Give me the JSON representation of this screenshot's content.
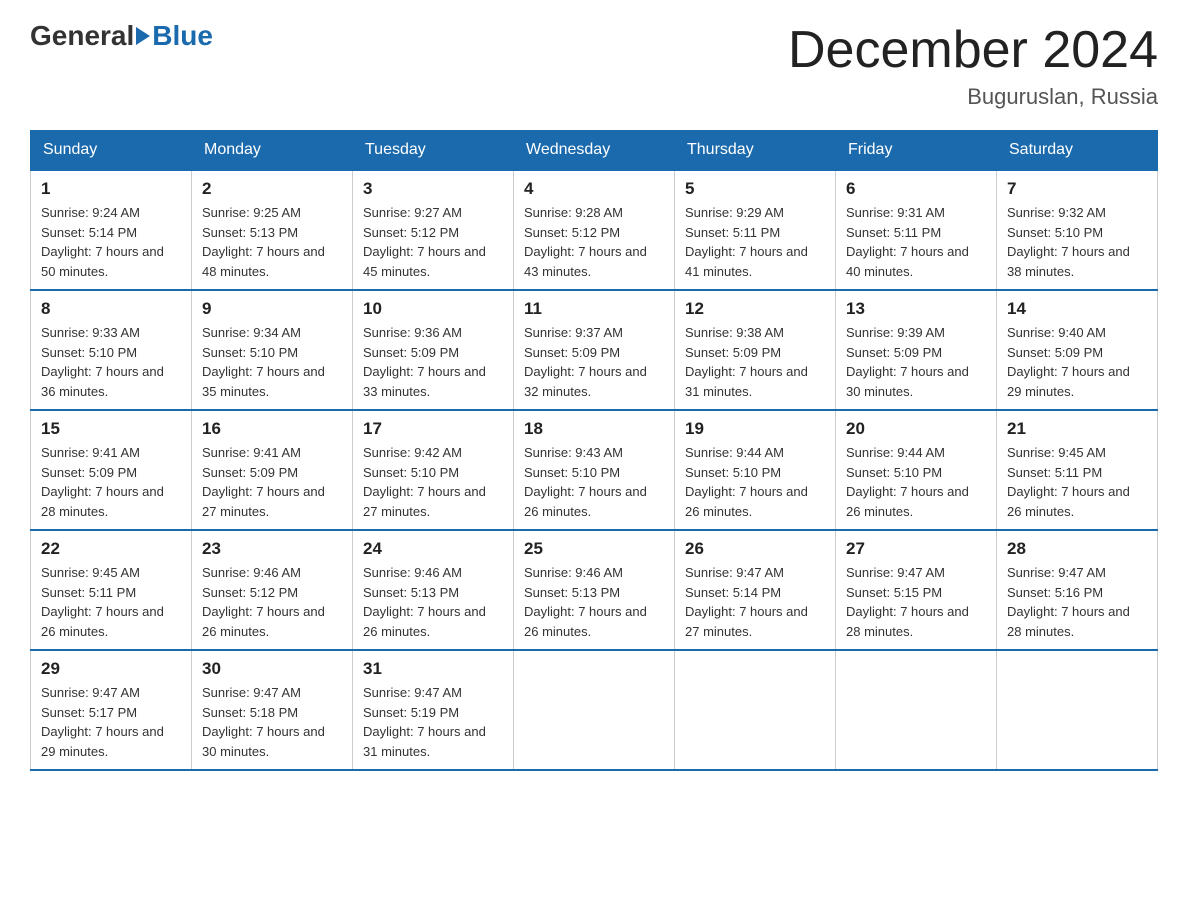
{
  "header": {
    "logo_general": "General",
    "logo_blue": "Blue",
    "month_title": "December 2024",
    "location": "Buguruslan, Russia"
  },
  "days_of_week": [
    "Sunday",
    "Monday",
    "Tuesday",
    "Wednesday",
    "Thursday",
    "Friday",
    "Saturday"
  ],
  "weeks": [
    [
      {
        "day": "1",
        "sunrise": "9:24 AM",
        "sunset": "5:14 PM",
        "daylight": "7 hours and 50 minutes."
      },
      {
        "day": "2",
        "sunrise": "9:25 AM",
        "sunset": "5:13 PM",
        "daylight": "7 hours and 48 minutes."
      },
      {
        "day": "3",
        "sunrise": "9:27 AM",
        "sunset": "5:12 PM",
        "daylight": "7 hours and 45 minutes."
      },
      {
        "day": "4",
        "sunrise": "9:28 AM",
        "sunset": "5:12 PM",
        "daylight": "7 hours and 43 minutes."
      },
      {
        "day": "5",
        "sunrise": "9:29 AM",
        "sunset": "5:11 PM",
        "daylight": "7 hours and 41 minutes."
      },
      {
        "day": "6",
        "sunrise": "9:31 AM",
        "sunset": "5:11 PM",
        "daylight": "7 hours and 40 minutes."
      },
      {
        "day": "7",
        "sunrise": "9:32 AM",
        "sunset": "5:10 PM",
        "daylight": "7 hours and 38 minutes."
      }
    ],
    [
      {
        "day": "8",
        "sunrise": "9:33 AM",
        "sunset": "5:10 PM",
        "daylight": "7 hours and 36 minutes."
      },
      {
        "day": "9",
        "sunrise": "9:34 AM",
        "sunset": "5:10 PM",
        "daylight": "7 hours and 35 minutes."
      },
      {
        "day": "10",
        "sunrise": "9:36 AM",
        "sunset": "5:09 PM",
        "daylight": "7 hours and 33 minutes."
      },
      {
        "day": "11",
        "sunrise": "9:37 AM",
        "sunset": "5:09 PM",
        "daylight": "7 hours and 32 minutes."
      },
      {
        "day": "12",
        "sunrise": "9:38 AM",
        "sunset": "5:09 PM",
        "daylight": "7 hours and 31 minutes."
      },
      {
        "day": "13",
        "sunrise": "9:39 AM",
        "sunset": "5:09 PM",
        "daylight": "7 hours and 30 minutes."
      },
      {
        "day": "14",
        "sunrise": "9:40 AM",
        "sunset": "5:09 PM",
        "daylight": "7 hours and 29 minutes."
      }
    ],
    [
      {
        "day": "15",
        "sunrise": "9:41 AM",
        "sunset": "5:09 PM",
        "daylight": "7 hours and 28 minutes."
      },
      {
        "day": "16",
        "sunrise": "9:41 AM",
        "sunset": "5:09 PM",
        "daylight": "7 hours and 27 minutes."
      },
      {
        "day": "17",
        "sunrise": "9:42 AM",
        "sunset": "5:10 PM",
        "daylight": "7 hours and 27 minutes."
      },
      {
        "day": "18",
        "sunrise": "9:43 AM",
        "sunset": "5:10 PM",
        "daylight": "7 hours and 26 minutes."
      },
      {
        "day": "19",
        "sunrise": "9:44 AM",
        "sunset": "5:10 PM",
        "daylight": "7 hours and 26 minutes."
      },
      {
        "day": "20",
        "sunrise": "9:44 AM",
        "sunset": "5:10 PM",
        "daylight": "7 hours and 26 minutes."
      },
      {
        "day": "21",
        "sunrise": "9:45 AM",
        "sunset": "5:11 PM",
        "daylight": "7 hours and 26 minutes."
      }
    ],
    [
      {
        "day": "22",
        "sunrise": "9:45 AM",
        "sunset": "5:11 PM",
        "daylight": "7 hours and 26 minutes."
      },
      {
        "day": "23",
        "sunrise": "9:46 AM",
        "sunset": "5:12 PM",
        "daylight": "7 hours and 26 minutes."
      },
      {
        "day": "24",
        "sunrise": "9:46 AM",
        "sunset": "5:13 PM",
        "daylight": "7 hours and 26 minutes."
      },
      {
        "day": "25",
        "sunrise": "9:46 AM",
        "sunset": "5:13 PM",
        "daylight": "7 hours and 26 minutes."
      },
      {
        "day": "26",
        "sunrise": "9:47 AM",
        "sunset": "5:14 PM",
        "daylight": "7 hours and 27 minutes."
      },
      {
        "day": "27",
        "sunrise": "9:47 AM",
        "sunset": "5:15 PM",
        "daylight": "7 hours and 28 minutes."
      },
      {
        "day": "28",
        "sunrise": "9:47 AM",
        "sunset": "5:16 PM",
        "daylight": "7 hours and 28 minutes."
      }
    ],
    [
      {
        "day": "29",
        "sunrise": "9:47 AM",
        "sunset": "5:17 PM",
        "daylight": "7 hours and 29 minutes."
      },
      {
        "day": "30",
        "sunrise": "9:47 AM",
        "sunset": "5:18 PM",
        "daylight": "7 hours and 30 minutes."
      },
      {
        "day": "31",
        "sunrise": "9:47 AM",
        "sunset": "5:19 PM",
        "daylight": "7 hours and 31 minutes."
      },
      null,
      null,
      null,
      null
    ]
  ]
}
